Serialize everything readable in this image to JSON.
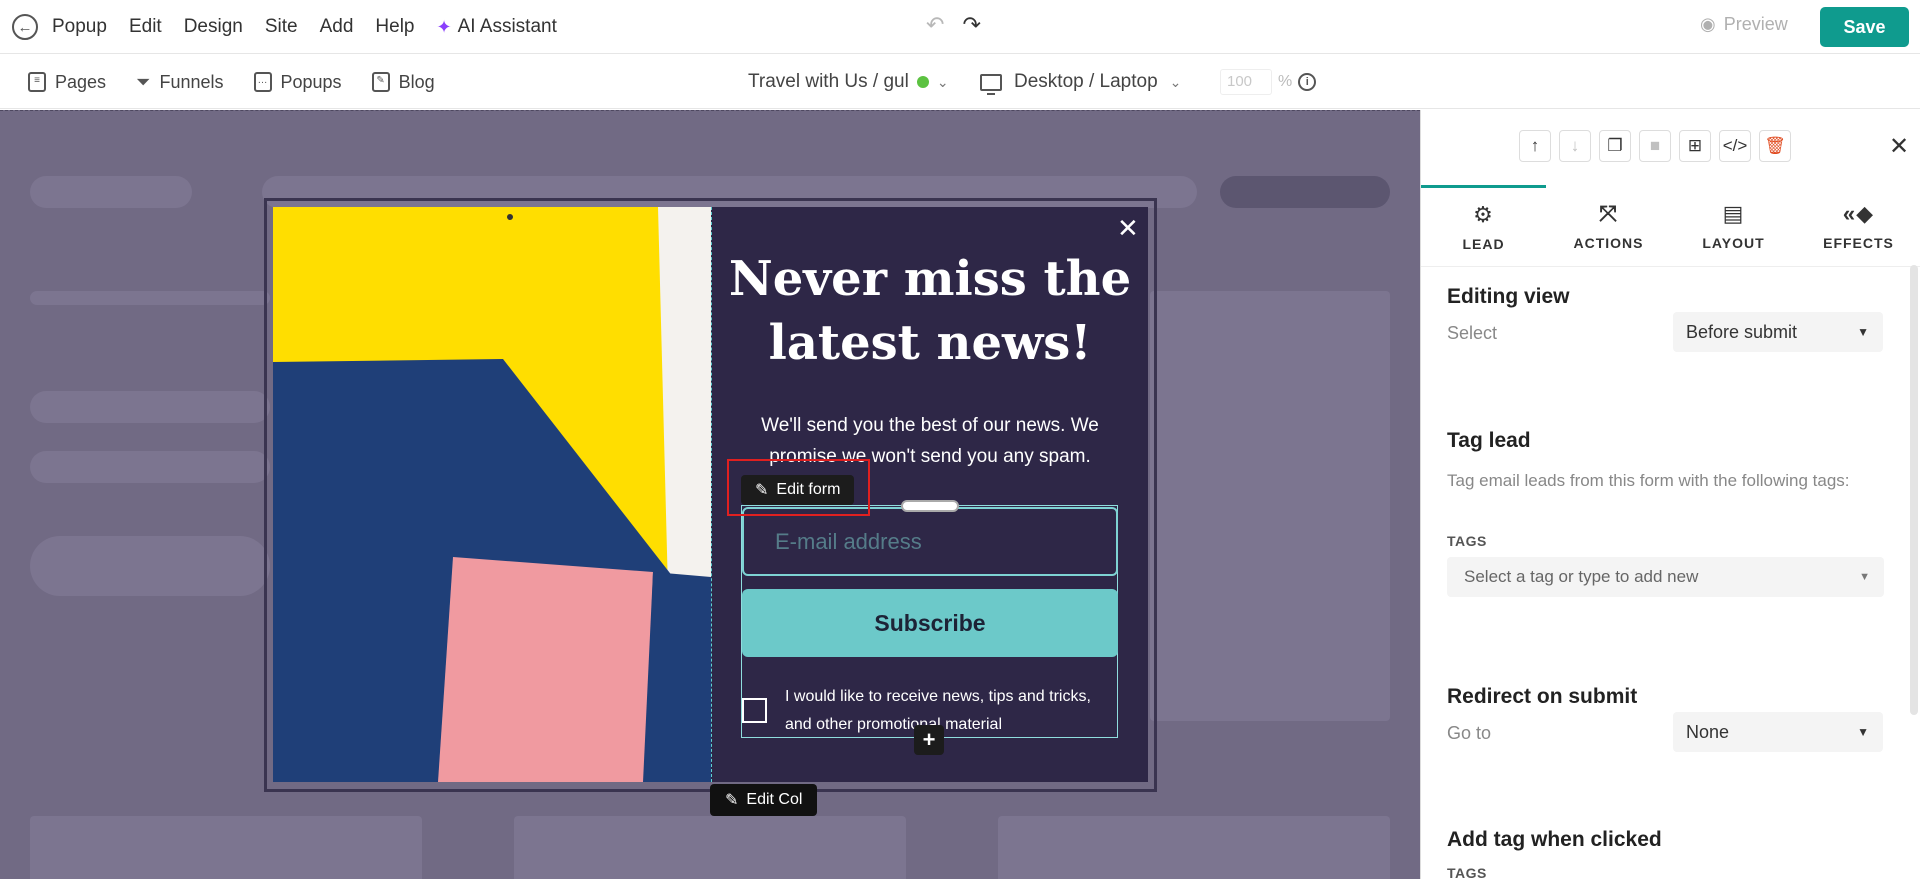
{
  "topbar": {
    "menu": [
      "Popup",
      "Edit",
      "Design",
      "Site",
      "Add",
      "Help"
    ],
    "ai_label": "AI Assistant",
    "preview_label": "Preview",
    "save_label": "Save"
  },
  "toolbar": {
    "nav": [
      "Pages",
      "Funnels",
      "Popups",
      "Blog"
    ],
    "site_label": "Travel with Us / gul",
    "device_label": "Desktop / Laptop",
    "zoom_value": "100",
    "zoom_unit": "%"
  },
  "popup": {
    "headline": "Never miss the latest news!",
    "subtext": "We'll send you the best of our news. We promise we won't send you any spam.",
    "edit_form_label": "Edit form",
    "email_placeholder": "E-mail address",
    "subscribe_label": "Subscribe",
    "consent_text": "I would like to receive news, tips and tricks, and other promotional material",
    "edit_col_label": "Edit Col"
  },
  "panel": {
    "tabs": [
      "LEAD",
      "ACTIONS",
      "LAYOUT",
      "EFFECTS"
    ],
    "editing_view": {
      "title": "Editing view",
      "label": "Select",
      "value": "Before submit"
    },
    "tag_lead": {
      "title": "Tag lead",
      "help": "Tag email leads from this form with the following tags:",
      "caption": "TAGS",
      "placeholder": "Select a tag or type to add new"
    },
    "redirect": {
      "title": "Redirect on submit",
      "label": "Go to",
      "value": "None"
    },
    "add_tag": {
      "title": "Add tag when clicked",
      "caption": "TAGS"
    }
  },
  "colors": {
    "accent": "#0f9b8e",
    "canvas": "#716a84",
    "popup_bg": "#2e2747",
    "subscribe_bg": "#6cc9c9",
    "delete": "#e04a1f"
  }
}
